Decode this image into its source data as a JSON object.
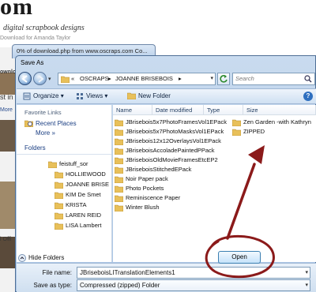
{
  "background": {
    "logo": "om",
    "tagline": "digital scrapbook designs",
    "download_for": "Download for Amanda Taylor",
    "left_fragments": [
      "ownlo",
      "st in",
      "More",
      "l Offi"
    ]
  },
  "download_window": {
    "title": "0% of download.php from www.oscraps.com Co..."
  },
  "dialog": {
    "title": "Save As",
    "breadcrumb": [
      "«",
      "OSCRAPS",
      "▸",
      "JOANNE BRISEBOIS",
      "▸"
    ],
    "search_placeholder": "Search",
    "toolbar": {
      "organize": "Organize",
      "views": "Views",
      "new_folder": "New Folder",
      "help": "?"
    },
    "nav": {
      "favorite_links": "Favorite Links",
      "links": [
        "Recent Places",
        "More »"
      ],
      "folders": "Folders",
      "tree": [
        "feistuff_sor",
        "HOLLIEWOOD",
        "JOANNE BRISE",
        "KIM De Smet",
        "KRISTA",
        "LAREN REID",
        "LISA Lambert"
      ]
    },
    "columns": [
      "Name",
      "Date modified",
      "Type",
      "Size"
    ],
    "files_left": [
      "JBrisebois5x7PhotoFramesVol1EPack",
      "JBrisebois5x7PhotoMasksVol1EPack",
      "JBrisebois12x12OverlaysVol1EPack",
      "JBriseboisAccoladePaintedPPack",
      "JBriseboisOldMovieFramesEtcEP2",
      "JBriseboisStitchedEPack",
      "Noir Paper pack",
      "Photo Pockets",
      "Reminiscence Paper",
      "Winter Blush"
    ],
    "files_right": [
      "Zen Garden -with Kathryn",
      "ZIPPED"
    ],
    "file_name_label": "File name:",
    "file_name_value": "JBriseboisLITranslationElements1",
    "save_type_label": "Save as type:",
    "save_type_value": "Compressed (zipped) Folder",
    "hide_folders": "Hide Folders",
    "open_button": "Open"
  },
  "colors": {
    "annotation": "#8b1a1a",
    "folder": "#e8c05a"
  }
}
